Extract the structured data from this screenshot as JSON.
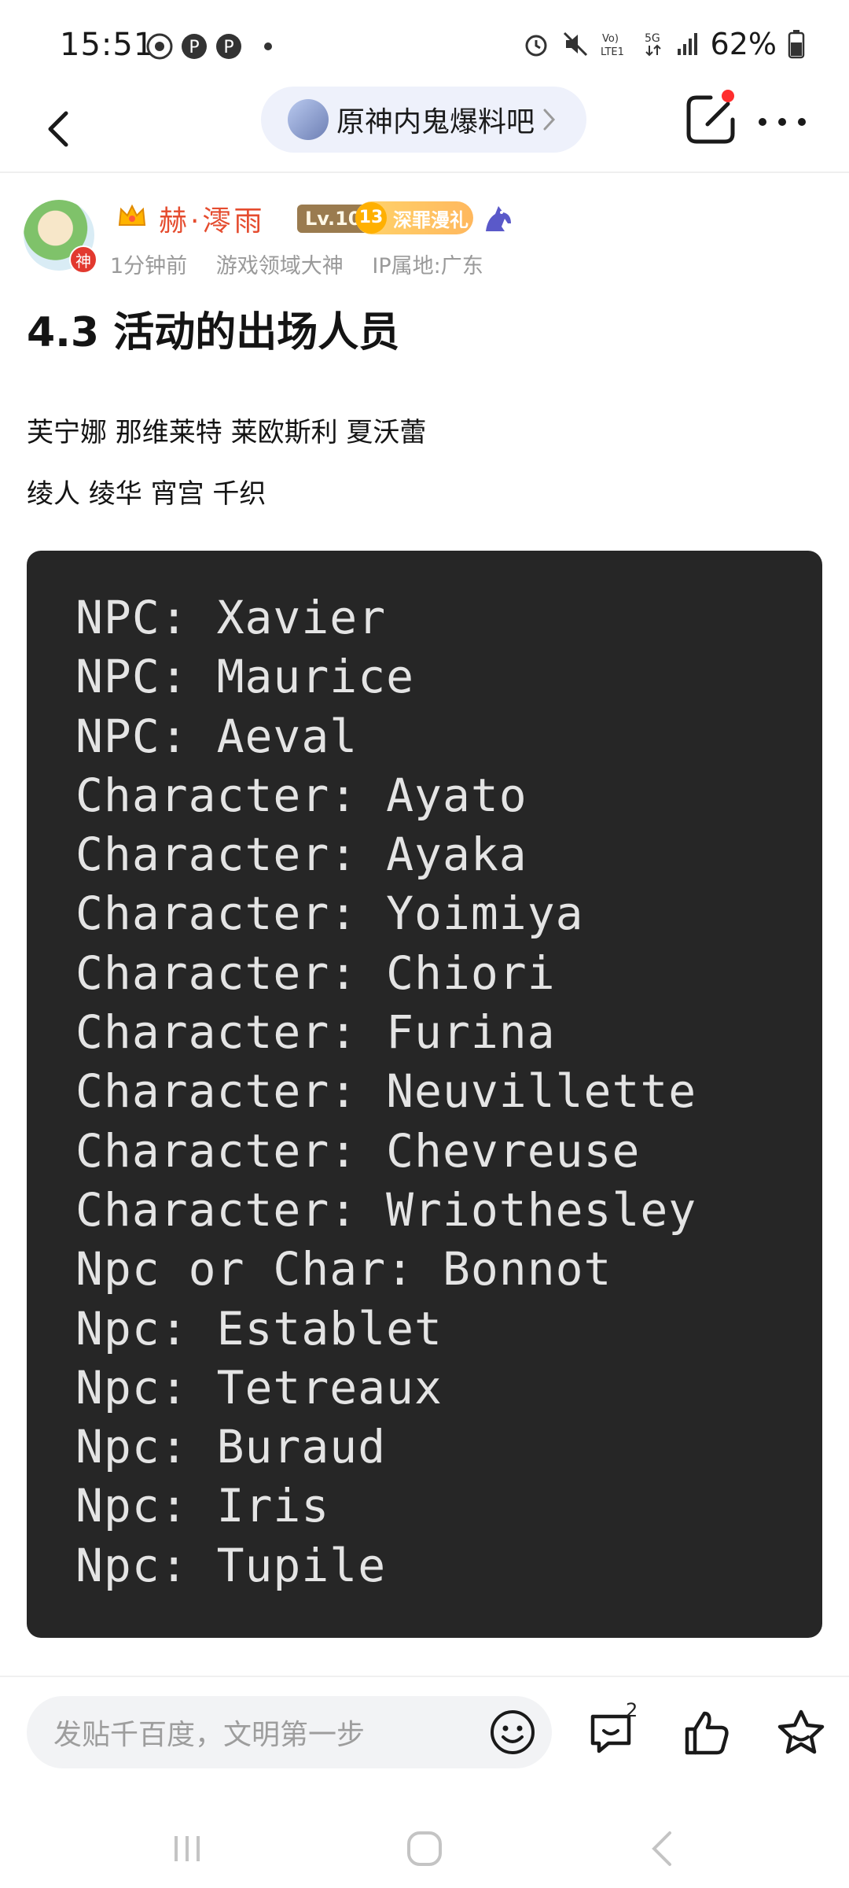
{
  "status_bar": {
    "time": "15:51",
    "battery": "62%",
    "network": "5G",
    "volte": "Vo) LTE1"
  },
  "nav": {
    "forum_name": "原神内鬼爆料吧"
  },
  "author": {
    "name": "赫·澪雨",
    "level": "Lv.10",
    "rank_number": "13",
    "rank_label": "深罪漫礼",
    "avatar_badge": "神",
    "time_ago": "1分钟前",
    "title": "游戏领域大神",
    "ip": "IP属地:广东"
  },
  "post": {
    "title": "4.3 活动的出场人员",
    "lines": [
      "芙宁娜 那维莱特 莱欧斯利 夏沃蕾",
      "绫人 绫华 宵宫 千织"
    ],
    "code_lines": [
      "NPC: Xavier",
      "NPC: Maurice",
      "NPC: Aeval",
      "Character: Ayato",
      "Character: Ayaka",
      "Character: Yoimiya",
      "Character: Chiori",
      "Character: Furina",
      "Character: Neuvillette",
      "Character: Chevreuse",
      "Character: Wriothesley",
      "Npc or Char: Bonnot",
      "Npc: Establet",
      "Npc: Tetreaux",
      "Npc: Buraud",
      "Npc: Iris",
      "Npc: Tupile"
    ]
  },
  "bottom_bar": {
    "comment_placeholder": "发贴千百度，文明第一步",
    "comment_count": "2"
  },
  "colors": {
    "accent_name": "#e54c2f",
    "code_bg": "#262626",
    "code_text": "#e4e4e4",
    "pill_bg": "#eef1fb"
  },
  "icons": [
    "chrome-icon",
    "pinterest-icon",
    "alarm-icon",
    "mute-icon",
    "signal-icon",
    "battery-icon",
    "back-icon",
    "chevron-right-icon",
    "edit-icon",
    "more-icon",
    "crown-icon",
    "horse-icon",
    "emoji-icon",
    "comment-icon",
    "like-icon",
    "favorite-icon"
  ]
}
